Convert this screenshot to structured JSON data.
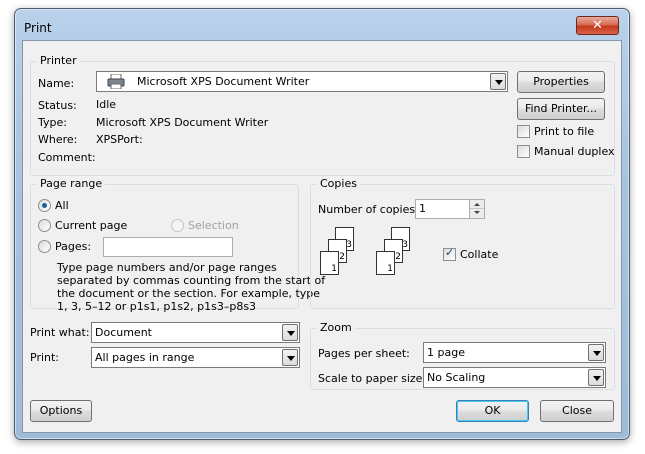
{
  "window": {
    "title": "Print",
    "close_glyph": "✕"
  },
  "printer": {
    "group_label": "Printer",
    "name_label": "Name:",
    "name_value": "Microsoft XPS Document Writer",
    "status_label": "Status:",
    "status_value": "Idle",
    "type_label": "Type:",
    "type_value": "Microsoft XPS Document Writer",
    "where_label": "Where:",
    "where_value": "XPSPort:",
    "comment_label": "Comment:",
    "properties_button": "Properties",
    "find_printer_button": "Find Printer...",
    "print_to_file": {
      "label": "Print to file",
      "checked": false
    },
    "manual_duplex": {
      "label": "Manual duplex",
      "checked": false
    }
  },
  "page_range": {
    "group_label": "Page range",
    "all": "All",
    "current_page": "Current page",
    "selection": "Selection",
    "pages": "Pages:",
    "pages_value": "",
    "help_lines": [
      "Type page numbers and/or page ranges",
      "separated by commas counting from the start of",
      "the document or the section. For example, type",
      "1, 3, 5–12 or p1s1, p1s2, p1s3–p8s3"
    ],
    "selected": "All"
  },
  "copies": {
    "group_label": "Copies",
    "number_label": "Number of copies:",
    "number_value": "1",
    "collate": {
      "label": "Collate",
      "checked": true
    },
    "page_numbers": [
      "3",
      "2",
      "1"
    ]
  },
  "print_what": {
    "label": "Print what:",
    "value": "Document"
  },
  "print": {
    "label": "Print:",
    "value": "All pages in range"
  },
  "zoom": {
    "group_label": "Zoom",
    "pages_per_sheet_label": "Pages per sheet:",
    "pages_per_sheet_value": "1 page",
    "scale_label": "Scale to paper size:",
    "scale_value": "No Scaling"
  },
  "buttons": {
    "options": "Options",
    "ok": "OK",
    "close": "Close"
  }
}
